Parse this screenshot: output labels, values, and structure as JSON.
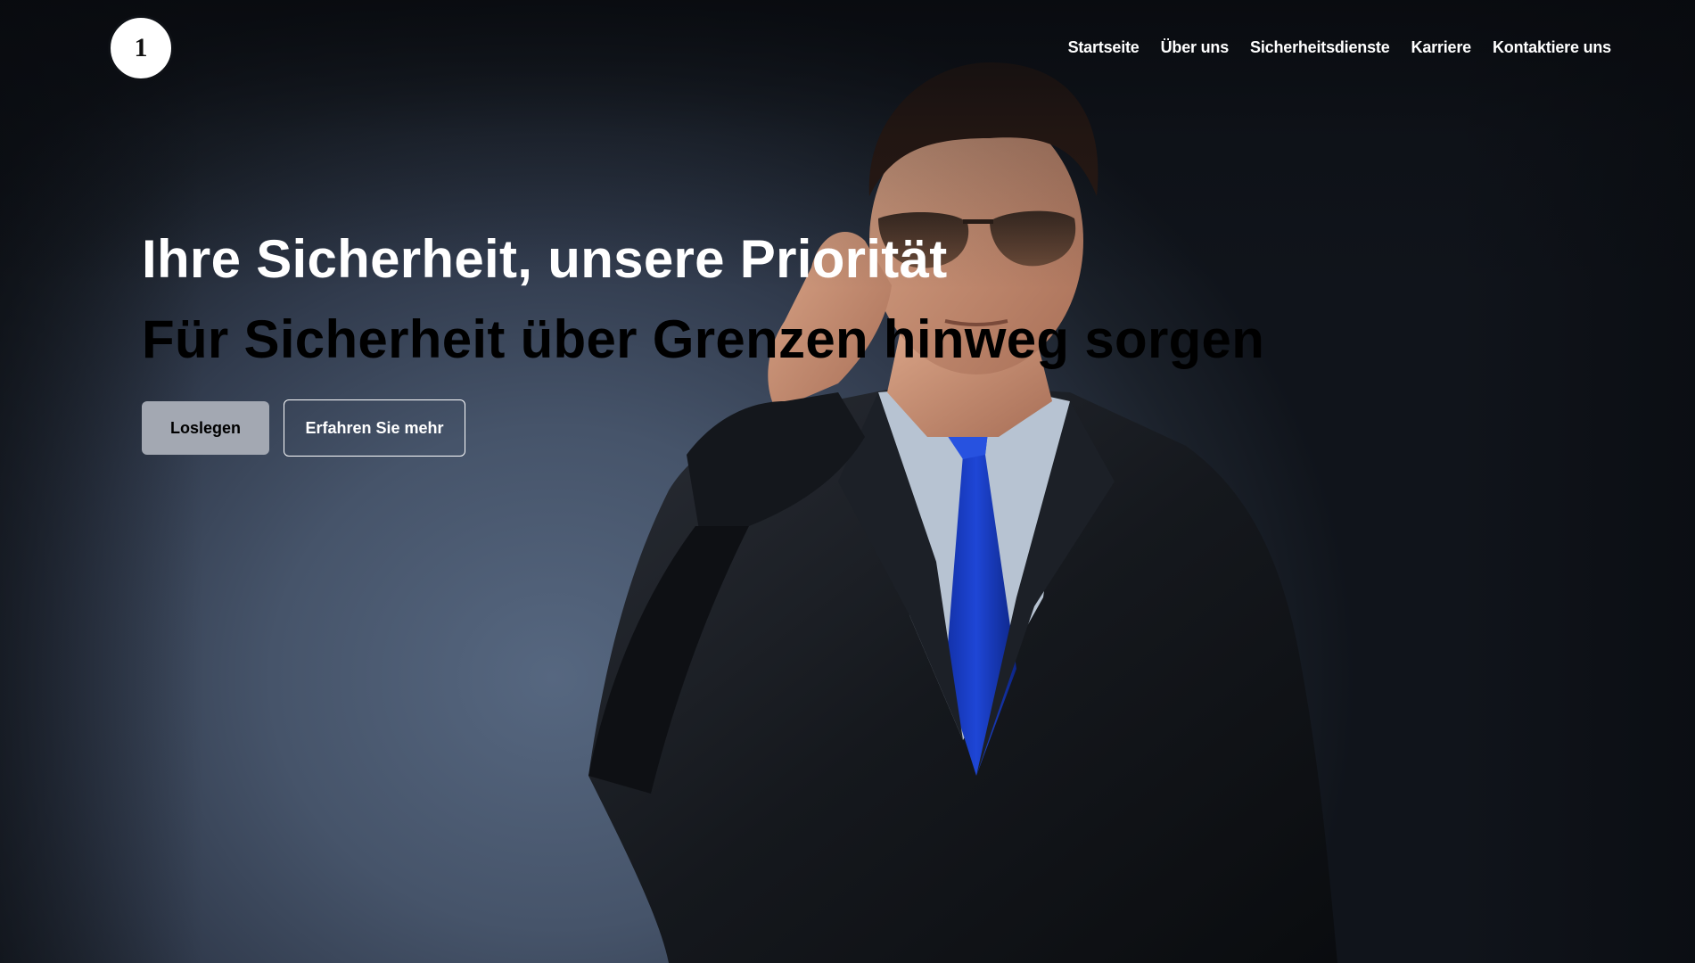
{
  "logo": {
    "text": "1"
  },
  "nav": {
    "items": [
      {
        "label": "Startseite"
      },
      {
        "label": "Über uns"
      },
      {
        "label": "Sicherheitsdienste"
      },
      {
        "label": "Karriere"
      },
      {
        "label": "Kontaktiere uns"
      }
    ]
  },
  "hero": {
    "title": "Ihre Sicherheit, unsere Priorität",
    "subtitle": "Für Sicherheit über Grenzen hinweg sorgen",
    "primary_button": "Loslegen",
    "secondary_button": "Erfahren Sie mehr"
  },
  "colors": {
    "background": "#46546a",
    "primary_button": "#a3a8b2",
    "tie": "#1a3fc4"
  }
}
